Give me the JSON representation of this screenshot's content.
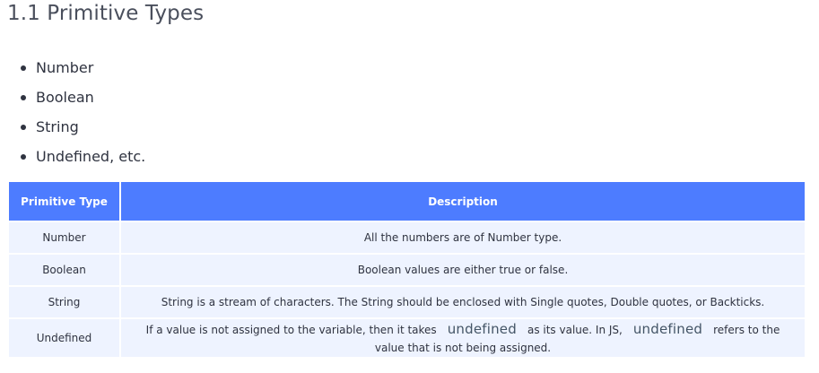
{
  "section": {
    "title": "1.1 Primitive Types"
  },
  "list": {
    "items": [
      "Number",
      "Boolean",
      "String",
      "Undefined, etc."
    ]
  },
  "table": {
    "headers": [
      "Primitive Type",
      "Description"
    ],
    "rows": [
      {
        "type": "Number",
        "description": "All the numbers are of Number type."
      },
      {
        "type": "Boolean",
        "description": "Boolean values are either true or false."
      },
      {
        "type": "String",
        "description": "String is a stream of characters. The String should be enclosed with Single quotes, Double quotes, or Backticks."
      },
      {
        "type": "Undefined",
        "description_parts": [
          "If a value is not assigned to the variable, then it takes",
          "undefined",
          "as its value. In JS,",
          "undefined",
          "refers to the",
          "value that is not being assigned."
        ]
      }
    ]
  },
  "colors": {
    "header_bg": "#4d7cff",
    "row_bg": "#eef3ff"
  }
}
